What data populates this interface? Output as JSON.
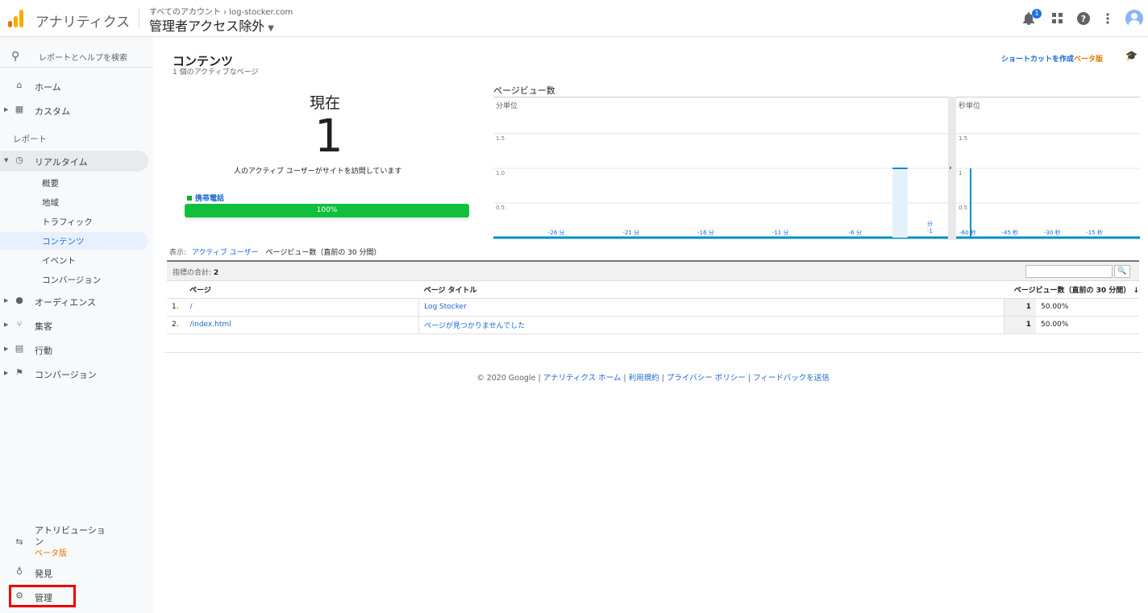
{
  "app": {
    "name": "アナリティクス",
    "breadcrumb_prefix": "すべてのアカウント",
    "breadcrumb_site": "log-stocker.com",
    "view_name": "管理者アクセス除外",
    "notification_count": "1"
  },
  "sidebar": {
    "search_placeholder": "レポートとヘルプを検索",
    "home": "ホーム",
    "custom": "カスタム",
    "reports_label": "レポート",
    "realtime": "リアルタイム",
    "realtime_sub": [
      "概要",
      "地域",
      "トラフィック",
      "コンテンツ",
      "イベント",
      "コンバージョン"
    ],
    "audience": "オーディエンス",
    "acquisition": "集客",
    "behavior": "行動",
    "conversion": "コンバージョン",
    "attribution": "アトリビューション",
    "attribution_beta": "ベータ版",
    "discover": "発見",
    "admin": "管理"
  },
  "content": {
    "title": "コンテンツ",
    "subtitle": "1 個のアクティブなページ",
    "shortcut": "ショートカットを作成",
    "shortcut_beta": "ベータ版",
    "now_label": "現在",
    "now_count": "1",
    "now_desc": "人のアクティブ ユーザーがサイトを訪問しています",
    "device_label": "携帯電話",
    "device_percent": "100%",
    "device_fraction": 1.0,
    "chart_title": "ページビュー数",
    "view_label": "表示:",
    "view_active": "アクティブ ユーザー",
    "view_current": "ページビュー数（直前の 30 分間）",
    "total_label": "指標の合計:",
    "total_value": "2",
    "columns": {
      "page": "ページ",
      "page_title": "ページ タイトル",
      "pageviews": "ページビュー数（直前の 30 分間）"
    },
    "rows": [
      {
        "num": "1.",
        "page": "/",
        "title": "Log Stocker",
        "value": "1",
        "pct": "50.00%"
      },
      {
        "num": "2.",
        "page": "/index.html",
        "title": "ページが見つかりませんでした",
        "value": "1",
        "pct": "50.00%"
      }
    ]
  },
  "chart_data": [
    {
      "type": "bar",
      "title": "ページビュー数",
      "unit_label": "分単位",
      "x": [
        -29,
        -28,
        -27,
        -26,
        -25,
        -24,
        -23,
        -22,
        -21,
        -20,
        -19,
        -18,
        -17,
        -16,
        -15,
        -14,
        -13,
        -12,
        -11,
        -10,
        -9,
        -8,
        -7,
        -6,
        -5,
        -4,
        -3,
        -2,
        -1
      ],
      "values": [
        0,
        0,
        0,
        0,
        0,
        0,
        0,
        0,
        0,
        0,
        0,
        0,
        0,
        0,
        0,
        0,
        0,
        0,
        0,
        0,
        0,
        0,
        0,
        0,
        0,
        0,
        1,
        0,
        0
      ],
      "tick_labels": [
        "-26 分",
        "-21 分",
        "-16 分",
        "-11 分",
        "-6 分",
        "分\n-1"
      ],
      "tick_x": [
        -26,
        -21,
        -16,
        -11,
        -6,
        -1
      ],
      "y_ticks": [
        "1.5",
        "1.0",
        "0.5"
      ],
      "y_tick_values": [
        1.5,
        1.0,
        0.5
      ],
      "ylim": [
        0,
        2
      ]
    },
    {
      "type": "bar",
      "unit_label": "秒単位",
      "x_range": [
        -60,
        0
      ],
      "spike_x": -59,
      "spike_value": 1,
      "tick_labels": [
        "-60 秒",
        "-45 秒",
        "-30 秒",
        "-15 秒"
      ],
      "tick_x": [
        -60,
        -45,
        -30,
        -15
      ],
      "y_ticks": [
        "1.5",
        "1",
        "0.5"
      ],
      "y_tick_values": [
        1.5,
        1,
        0.5
      ],
      "ylim": [
        0,
        2
      ]
    }
  ],
  "footer": {
    "copyright": "© 2020 Google",
    "links": [
      "アナリティクス ホーム",
      "利用規約",
      "プライバシー ポリシー",
      "フィードバックを送信"
    ]
  },
  "colors": {
    "accent": "#1a73e8",
    "bar_green": "#0fbf3d",
    "chart_blue": "#058dc7",
    "beta_orange": "#e37400"
  }
}
